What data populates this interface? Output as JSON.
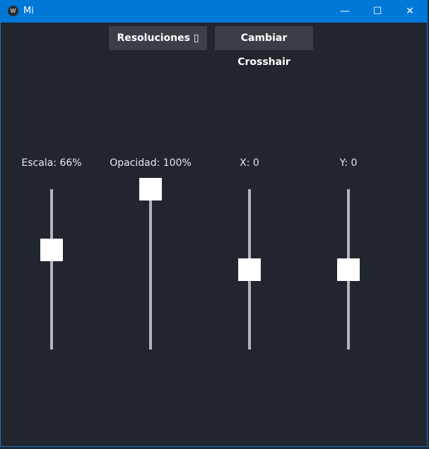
{
  "window": {
    "title": "Mi",
    "icon": "kivy-logo-icon",
    "minimize": "—",
    "maximize": "☐",
    "close": "✕",
    "titlebar_color": "#0078d7",
    "background": "#21252d"
  },
  "toolbar": {
    "resolutions_label": "Resoluciones ▯",
    "crosshair_label": "Cambiar Crosshair"
  },
  "sliders": [
    {
      "label": "Escala: 66%",
      "position": 0.62
    },
    {
      "label": "Opacidad: 100%",
      "position": 1.0
    },
    {
      "label": "X: 0",
      "position": 0.5
    },
    {
      "label": "Y: 0",
      "position": 0.5
    }
  ]
}
